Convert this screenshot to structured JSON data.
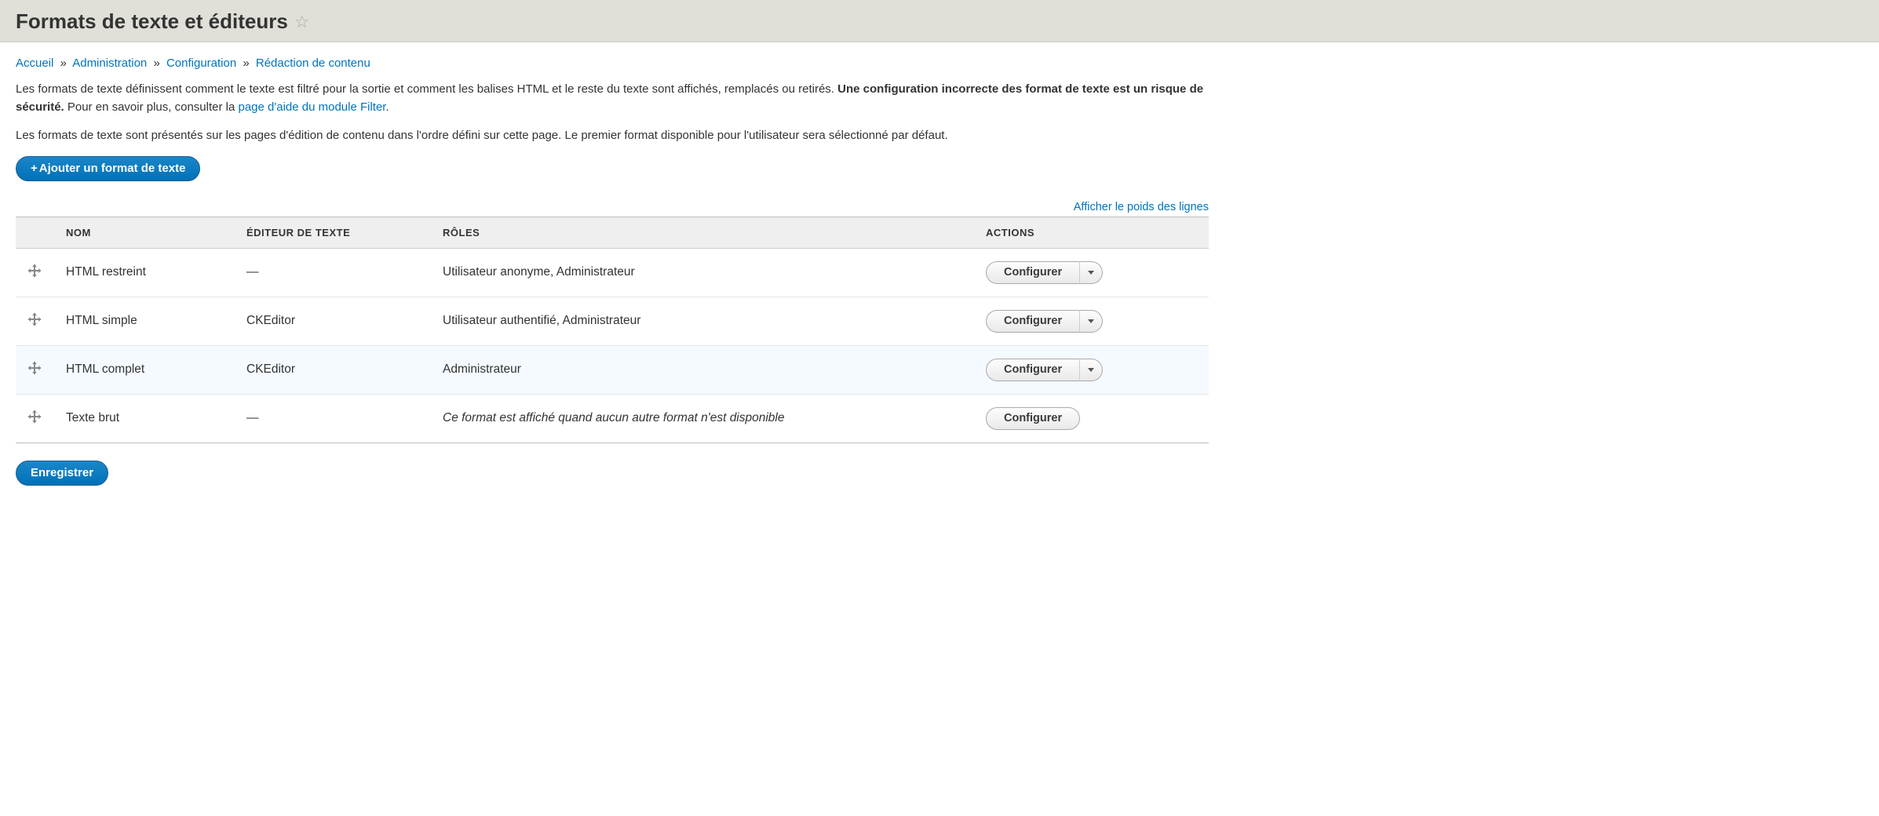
{
  "page": {
    "title": "Formats de texte et éditeurs"
  },
  "breadcrumb": {
    "home": "Accueil",
    "admin": "Administration",
    "config": "Configuration",
    "authoring": "Rédaction de contenu",
    "sep": "»"
  },
  "intro": {
    "p1_a": "Les formats de texte définissent comment le texte est filtré pour la sortie et comment les balises HTML et le reste du texte sont affichés, remplacés ou retirés. ",
    "p1_strong": "Une configuration incorrecte des format de texte est un risque de sécurité.",
    "p1_b": " Pour en savoir plus, consulter la ",
    "p1_link": "page d'aide du module Filter",
    "p1_c": ".",
    "p2": "Les formats de texte sont présentés sur les pages d'édition de contenu dans l'ordre défini sur cette page. Le premier format disponible pour l'utilisateur sera sélectionné par défaut."
  },
  "buttons": {
    "add_format": "Ajouter un format de texte",
    "save": "Enregistrer",
    "show_weights": "Afficher le poids des lignes",
    "configure": "Configurer"
  },
  "table": {
    "headers": {
      "name": "NOM",
      "editor": "ÉDITEUR DE TEXTE",
      "roles": "RÔLES",
      "actions": "ACTIONS"
    },
    "rows": [
      {
        "name": "HTML restreint",
        "editor": "—",
        "roles": "Utilisateur anonyme, Administrateur",
        "has_drop": true,
        "italic": false,
        "highlight": false
      },
      {
        "name": "HTML simple",
        "editor": "CKEditor",
        "roles": "Utilisateur authentifié, Administrateur",
        "has_drop": true,
        "italic": false,
        "highlight": false
      },
      {
        "name": "HTML complet",
        "editor": "CKEditor",
        "roles": "Administrateur",
        "has_drop": true,
        "italic": false,
        "highlight": true
      },
      {
        "name": "Texte brut",
        "editor": "—",
        "roles": "Ce format est affiché quand aucun autre format n'est disponible",
        "has_drop": false,
        "italic": true,
        "highlight": false
      }
    ]
  }
}
